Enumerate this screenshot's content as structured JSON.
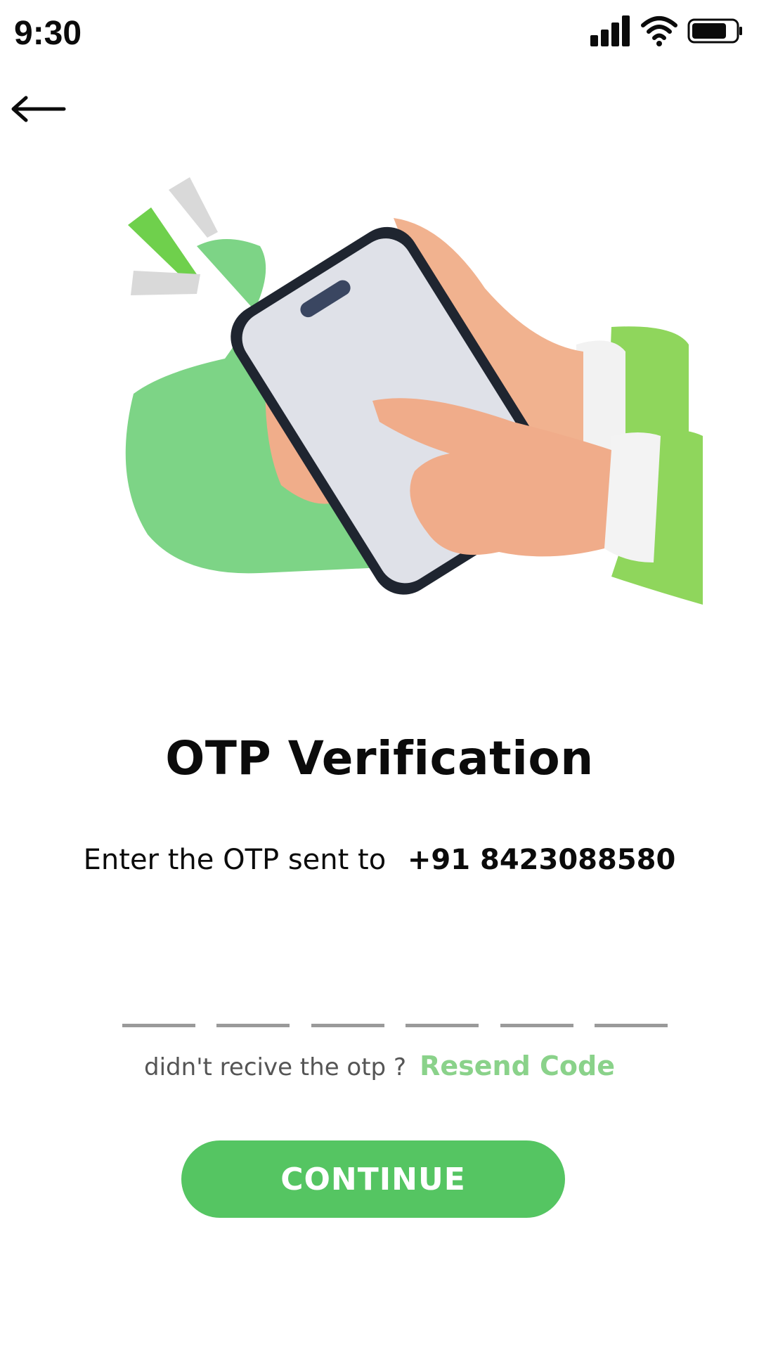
{
  "status_bar": {
    "time": "9:30",
    "icons": [
      "signal-icon",
      "wifi-icon",
      "battery-icon"
    ]
  },
  "nav": {
    "back_icon": "arrow-left-icon"
  },
  "hero": {
    "illustration": "hand-holding-phone-illustration"
  },
  "title": "OTP Verification",
  "subtitle": {
    "text": "Enter the OTP sent to",
    "phone": "+91 8423088580"
  },
  "otp": {
    "length": 6,
    "values": [
      "",
      "",
      "",
      "",
      "",
      ""
    ]
  },
  "resend": {
    "question": "didn't recive the otp ?",
    "link": "Resend Code"
  },
  "continue_label": "CONTINUE",
  "colors": {
    "accent": "#55c562",
    "accent_light": "#8ad28a",
    "blob": "#7dd486",
    "text": "#0b0b0b",
    "muted": "#555555"
  }
}
